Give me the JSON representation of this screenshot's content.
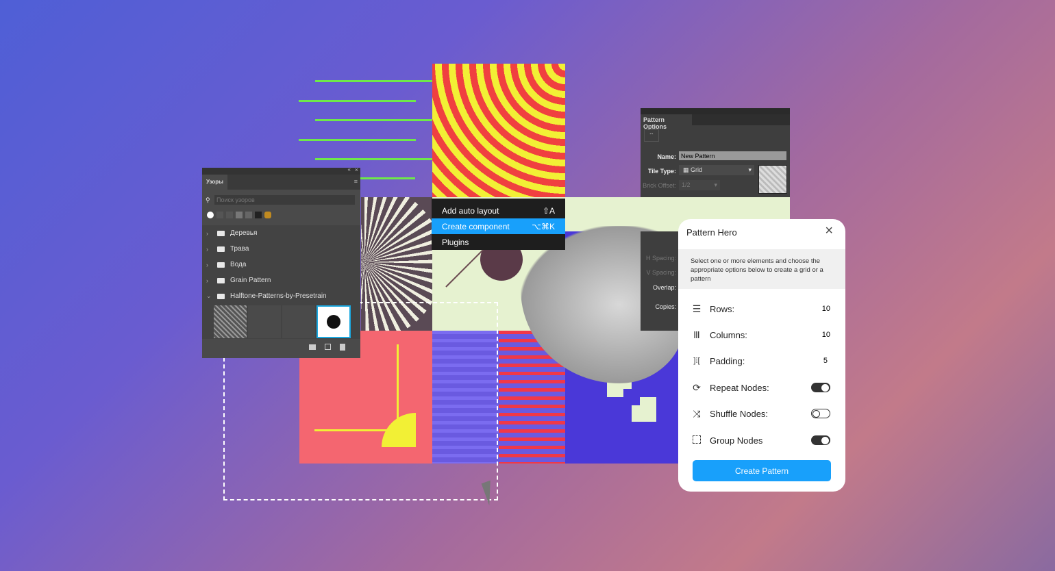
{
  "colors": {
    "accent": "#18a0fb",
    "selection": "#1aa8e0",
    "art_red": "#f04040",
    "art_yellow": "#f2f035",
    "art_green": "#6ee84a",
    "art_blue": "#4a38d8"
  },
  "patterns_panel": {
    "tab": "Узоры",
    "search_placeholder": "Поиск узоров",
    "items": [
      {
        "label": "Деревья",
        "expanded": false
      },
      {
        "label": "Трава",
        "expanded": false
      },
      {
        "label": "Вода",
        "expanded": false
      },
      {
        "label": "Grain Pattern",
        "expanded": false
      },
      {
        "label": "Halftone-Patterns-by-Presetrain",
        "expanded": true
      }
    ],
    "footer_icons": [
      "folder-icon",
      "new-pattern-icon",
      "trash-icon"
    ]
  },
  "context_menu": {
    "items": [
      {
        "label": "Add auto layout",
        "shortcut": "⇧A"
      },
      {
        "label": "Create component",
        "shortcut": "⌥⌘K",
        "active": true
      },
      {
        "label": "Plugins",
        "shortcut": ""
      }
    ]
  },
  "pattern_options": {
    "title": "Pattern Options",
    "name_label": "Name:",
    "name_value": "New Pattern",
    "tile_type_label": "Tile Type:",
    "tile_type_value": "Grid",
    "brick_offset_label": "Brick Offset:",
    "brick_offset_value": "1/2",
    "h_spacing_label": "H Spacing:",
    "v_spacing_label": "V Spacing:",
    "overlap_label": "Overlap:",
    "copies_label": "Copies:"
  },
  "pattern_hero": {
    "title": "Pattern Hero",
    "description": "Select one or more elements and choose the appropriate options below to create a grid or a pattern",
    "rows_label": "Rows:",
    "rows_value": "10",
    "columns_label": "Columns:",
    "columns_value": "10",
    "padding_label": "Padding:",
    "padding_value": "5",
    "repeat_label": "Repeat Nodes:",
    "repeat_on": true,
    "shuffle_label": "Shuffle Nodes:",
    "shuffle_on": false,
    "group_label": "Group Nodes",
    "group_on": true,
    "button": "Create Pattern"
  }
}
